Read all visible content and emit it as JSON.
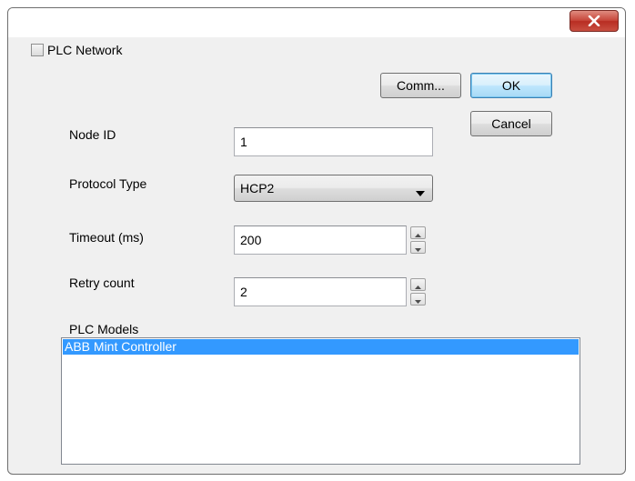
{
  "window": {
    "close_icon": "close-x-icon"
  },
  "form": {
    "plc_network_label": "PLC Network",
    "plc_network_checked": false,
    "node_id_label": "Node ID",
    "node_id_value": "1",
    "protocol_type_label": "Protocol Type",
    "protocol_type_value": "HCP2",
    "timeout_label": "Timeout (ms)",
    "timeout_value": "200",
    "retry_label": "Retry count",
    "retry_value": "2",
    "plc_models_label": "PLC Models",
    "plc_models": [
      {
        "label": "ABB Mint Controller",
        "selected": true
      }
    ]
  },
  "buttons": {
    "comm_label": "Comm...",
    "ok_label": "OK",
    "cancel_label": "Cancel"
  },
  "colors": {
    "selection": "#3399ff",
    "close_button": "#c7463a",
    "dialog_bg": "#f0f0f0"
  }
}
